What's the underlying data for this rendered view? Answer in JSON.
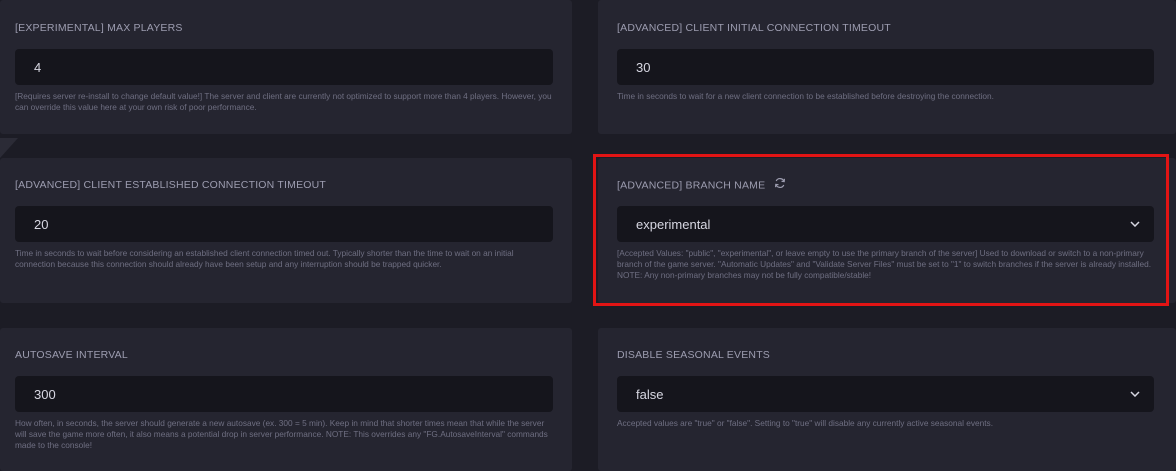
{
  "settings": {
    "max_players": {
      "title": "[EXPERIMENTAL] MAX PLAYERS",
      "value": "4",
      "description": "[Requires server re-install to change default value!] The server and client are currently not optimized to support more than 4 players. However, you can override this value here at your own risk of poor performance."
    },
    "client_initial_timeout": {
      "title": "[ADVANCED] CLIENT INITIAL CONNECTION TIMEOUT",
      "value": "30",
      "description": "Time in seconds to wait for a new client connection to be established before destroying the connection."
    },
    "client_established_timeout": {
      "title": "[ADVANCED] CLIENT ESTABLISHED CONNECTION TIMEOUT",
      "value": "20",
      "description": "Time in seconds to wait before considering an established client connection timed out. Typically shorter than the time to wait on an initial connection because this connection should already have been setup and any interruption should be trapped quicker."
    },
    "branch_name": {
      "title": "[ADVANCED] BRANCH NAME",
      "value": "experimental",
      "description": "[Accepted Values: \"public\", \"experimental\", or leave empty to use the primary branch of the server] Used to download or switch to a non-primary branch of the game server. \"Automatic Updates\" and \"Validate Server Files\" must be set to \"1\" to switch branches if the server is already installed. NOTE: Any non-primary branches may not be fully compatible/stable!"
    },
    "autosave_interval": {
      "title": "AUTOSAVE INTERVAL",
      "value": "300",
      "description": "How often, in seconds, the server should generate a new autosave (ex. 300 = 5 min). Keep in mind that shorter times mean that while the server will save the game more often, it also means a potential drop in server performance. NOTE: This overrides any \"FG.AutosaveInterval\" commands made to the console!"
    },
    "disable_seasonal_events": {
      "title": "DISABLE SEASONAL EVENTS",
      "value": "false",
      "description": "Accepted values are \"true\" or \"false\". Setting to \"true\" will disable any currently active seasonal events."
    }
  },
  "icons": {
    "branch_name": "refresh-icon",
    "select": "chevron-down-icon"
  },
  "colors": {
    "highlight": "#e21414",
    "background": "#1c1c25",
    "card": "#252530",
    "field": "#15151c"
  }
}
